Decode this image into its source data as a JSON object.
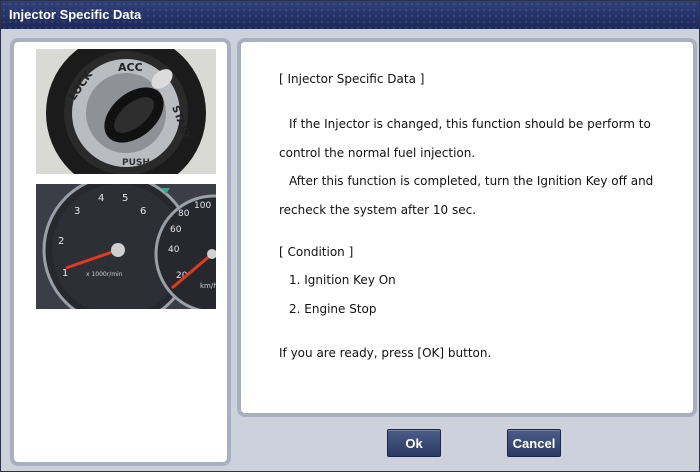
{
  "window": {
    "title": "Injector Specific Data"
  },
  "images": {
    "ignition": {
      "lock": "LOCK",
      "acc": "ACC",
      "start": "START",
      "push": "PUSH"
    },
    "gauge": {
      "ticks_left": [
        "1",
        "2",
        "3",
        "4",
        "5",
        "6"
      ],
      "ticks_right": [
        "20",
        "40",
        "60",
        "80",
        "100"
      ],
      "unit": "x 1000r/min",
      "unit_right": "km/h"
    }
  },
  "message": {
    "heading": "[ Injector Specific Data ]",
    "p1_line1": "If the Injector is changed, this function should be perform to",
    "p1_line2": "control the normal fuel injection.",
    "p2_line1": "After this function is completed, turn the Ignition Key off and",
    "p2_line2": "recheck the system after 10 sec.",
    "condition_heading": "[ Condition ]",
    "condition_1": "1. Ignition Key On",
    "condition_2": "2. Engine Stop",
    "prompt": "If you are ready, press [OK] button."
  },
  "buttons": {
    "ok": "Ok",
    "cancel": "Cancel"
  }
}
